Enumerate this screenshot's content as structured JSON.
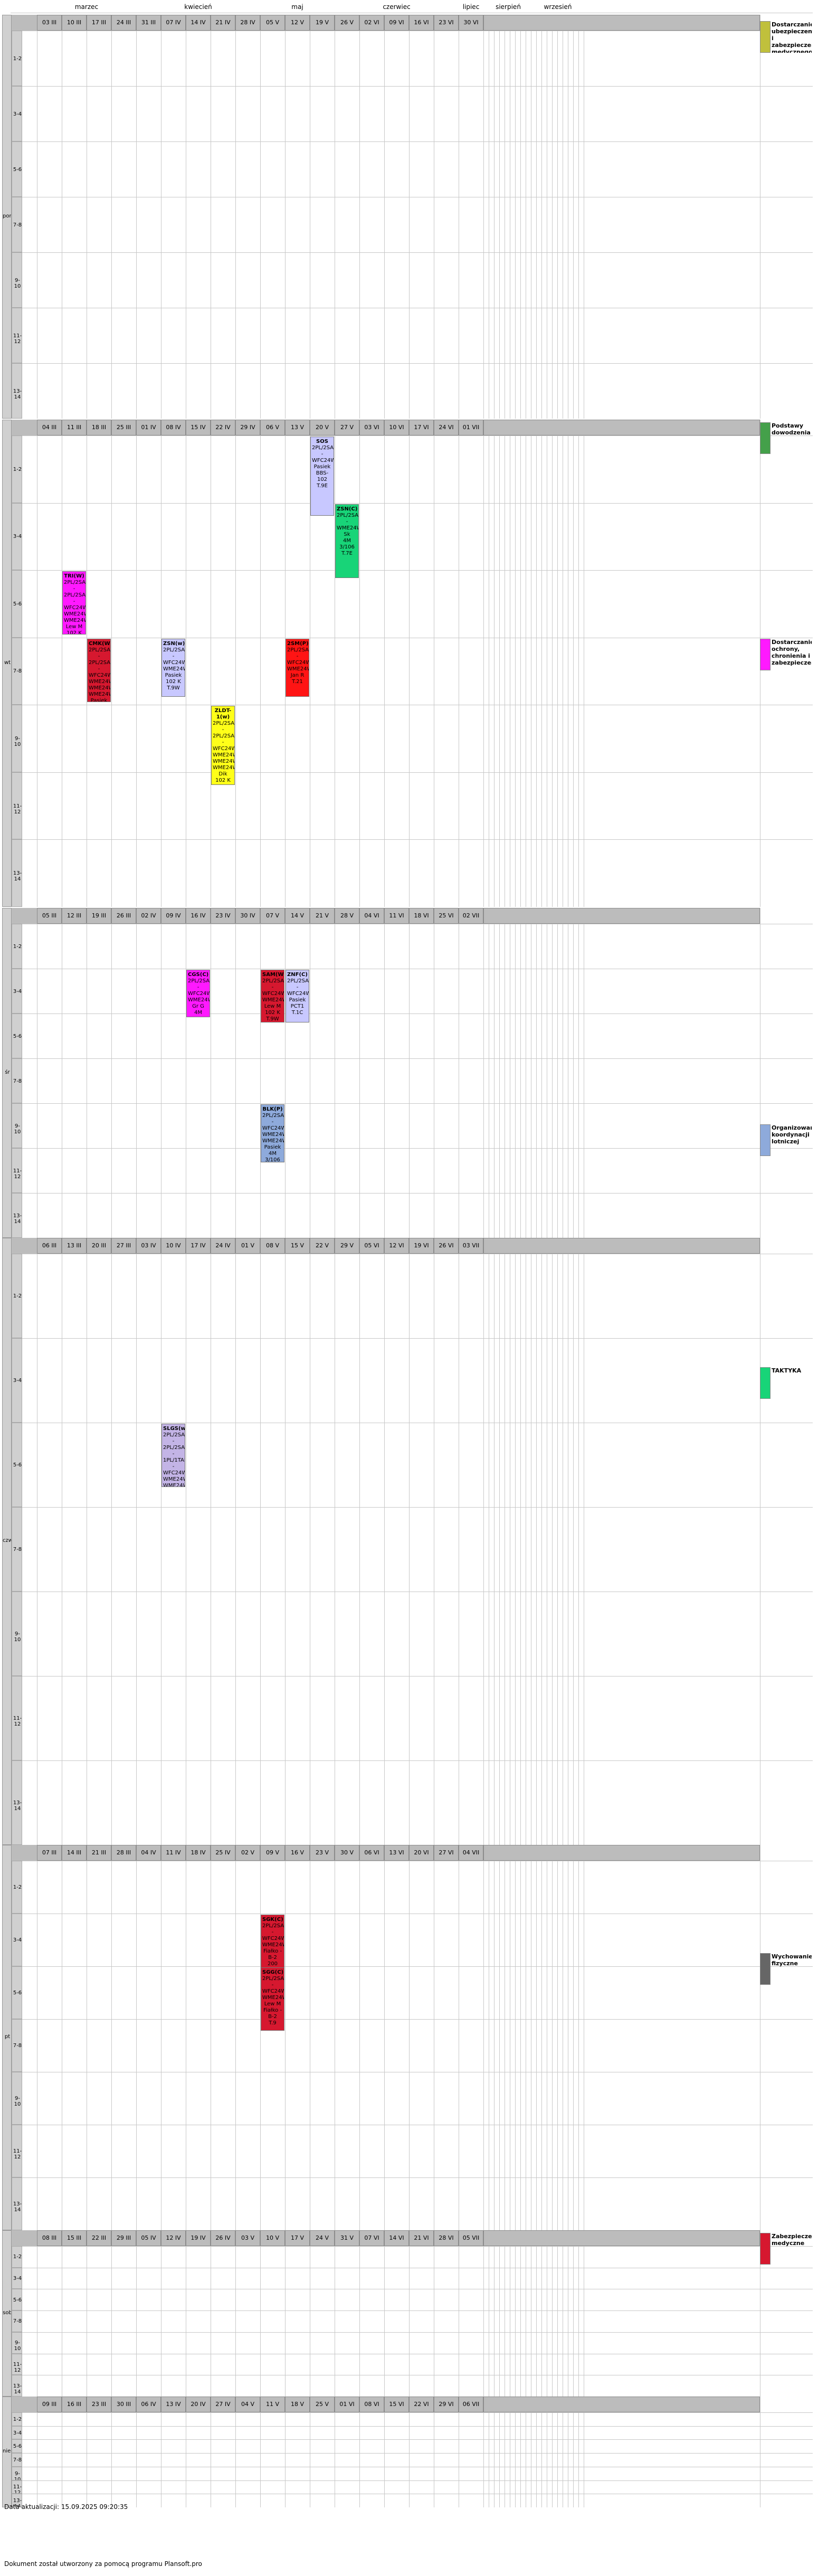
{
  "months": [
    "marzec",
    "kwiecień",
    "maj",
    "czerwiec",
    "lipiec",
    "sierpień",
    "wrzesień"
  ],
  "week_dates": {
    "pon": [
      "03 III",
      "10 III",
      "17 III",
      "24 III",
      "31 III",
      "07 IV",
      "14 IV",
      "21 IV",
      "28 IV",
      "05 V",
      "12 V",
      "19 V",
      "26 V",
      "02 VI",
      "09 VI",
      "16 VI",
      "23 VI",
      "30 VI"
    ],
    "wt": [
      "04 III",
      "11 III",
      "18 III",
      "25 III",
      "01 IV",
      "08 IV",
      "15 IV",
      "22 IV",
      "29 IV",
      "06 V",
      "13 V",
      "20 V",
      "27 V",
      "03 VI",
      "10 VI",
      "17 VI",
      "24 VI",
      "01 VII"
    ],
    "sr": [
      "05 III",
      "12 III",
      "19 III",
      "26 III",
      "02 IV",
      "09 IV",
      "16 IV",
      "23 IV",
      "30 IV",
      "07 V",
      "14 V",
      "21 V",
      "28 V",
      "04 VI",
      "11 VI",
      "18 VI",
      "25 VI",
      "02 VII"
    ],
    "czw": [
      "06 III",
      "13 III",
      "20 III",
      "27 III",
      "03 IV",
      "10 IV",
      "17 IV",
      "24 IV",
      "01 V",
      "08 V",
      "15 V",
      "22 V",
      "29 V",
      "05 VI",
      "12 VI",
      "19 VI",
      "26 VI",
      "03 VII"
    ],
    "pt": [
      "07 III",
      "14 III",
      "21 III",
      "28 III",
      "04 IV",
      "11 IV",
      "18 IV",
      "25 IV",
      "02 V",
      "09 V",
      "16 V",
      "23 V",
      "30 V",
      "06 VI",
      "13 VI",
      "20 VI",
      "27 VI",
      "04 VII"
    ],
    "sob": [
      "08 III",
      "15 III",
      "22 III",
      "29 III",
      "05 IV",
      "12 IV",
      "19 IV",
      "26 IV",
      "03 V",
      "10 V",
      "17 V",
      "24 V",
      "31 V",
      "07 VI",
      "14 VI",
      "21 VI",
      "28 VI",
      "05 VII"
    ],
    "niedz": [
      "09 III",
      "16 III",
      "23 III",
      "30 III",
      "06 IV",
      "13 IV",
      "20 IV",
      "27 IV",
      "04 V",
      "11 V",
      "18 V",
      "25 V",
      "01 VI",
      "08 VI",
      "15 VI",
      "22 VI",
      "29 VI",
      "06 VII"
    ]
  },
  "days": [
    {
      "name": "pon",
      "slots": [
        "1-2",
        "3-4",
        "5-6",
        "7-8",
        "9-10",
        "11-12",
        "13-14"
      ]
    },
    {
      "name": "wt",
      "slots": [
        "1-2",
        "3-4",
        "5-6",
        "7-8",
        "9-10",
        "11-12",
        "13-14"
      ]
    },
    {
      "name": "śr",
      "slots": [
        "1-2",
        "3-4",
        "5-6",
        "7-8",
        "9-10",
        "11-12",
        "13-14"
      ]
    },
    {
      "name": "czw",
      "slots": [
        "1-2",
        "3-4",
        "5-6",
        "7-8",
        "9-10",
        "11-12",
        "13-14"
      ]
    },
    {
      "name": "pt",
      "slots": [
        "1-2",
        "3-4",
        "5-6",
        "7-8",
        "9-10",
        "11-12",
        "13-14"
      ]
    },
    {
      "name": "sob",
      "slots": [
        "1-2",
        "3-4",
        "5-6",
        "7-8",
        "9-10",
        "11-12",
        "13-14"
      ]
    },
    {
      "name": "niedz",
      "slots": [
        "1-2",
        "3-4",
        "5-6",
        "7-8",
        "9-10",
        "11-12",
        "13-14"
      ]
    }
  ],
  "events": [
    {
      "title": "TUM(C)",
      "lines": [
        "2PL/2SAP -",
        "WFC24WC0",
        "WME24WC0",
        "Fiałko - B-2",
        "Fiałko - B-2",
        "208",
        "T.9"
      ],
      "color": "#d6182f"
    },
    {
      "title": "SGK(C)",
      "lines": [
        "2PL/2SAP -",
        "WFC24WC0",
        "WME24WC0",
        "Fiałko - B-2",
        "200",
        "T.9"
      ],
      "color": "#d6182f"
    },
    {
      "title": "SGG(C)",
      "lines": [
        "2PL/2SAP -",
        "WFC24WC0",
        "WME24WC0",
        "Lew M",
        "Fiałko - B-2",
        "T.9"
      ],
      "color": "#d6182f"
    },
    {
      "title": "SLGS(w)",
      "lines": [
        "2PL/2SAP -",
        "2PL/2SAP -",
        "1PL/1TAP -",
        "WFC24WC0",
        "WME24WC0",
        "WME24WC0",
        "WME24WC0",
        "WBI24WC0",
        "Krik",
        "016 S",
        "T.9W"
      ],
      "color": "#c3b4e6"
    },
    {
      "title": "2SM(P)",
      "lines": [
        "2PL/2SAP -",
        "WFC24WC0",
        "WME24WC0",
        "Jan R",
        "T.21"
      ],
      "color": "#ff1414"
    },
    {
      "title": "SOS",
      "lines": [
        "2PL/2SAP -",
        "WFC24WC0",
        "Pasiek",
        "BBS-102",
        "T.9E"
      ],
      "color": "#c8c8ff"
    },
    {
      "title": "ZSN(C)",
      "lines": [
        "2PL/2SAP -",
        "WME24WC0",
        "Sk",
        "4M 3/106",
        "T.7E"
      ],
      "color": "#18d478"
    },
    {
      "title": "TRI(W)",
      "lines": [
        "2PL/2SAP -",
        "2PL/2SAP -",
        "WFC24WC0",
        "WME24WC0",
        "WME24WC0",
        "Lew M",
        "102 K",
        "T.9W"
      ],
      "color": "#ff19ff"
    },
    {
      "title": "CMK(W)",
      "lines": [
        "2PL/2SAP -",
        "2PL/2SAP -",
        "WFC24WC0",
        "WME24WC0",
        "WME24WC0",
        "WME24WC0",
        "Pasiek",
        "102 K",
        "T.9W"
      ],
      "color": "#d6182f"
    },
    {
      "title": "ZSN(w)",
      "lines": [
        "2PL/2SAP -",
        "WFC24WC0",
        "WME24WC0",
        "Pasiek",
        "102 K",
        "T.9W"
      ],
      "color": "#c8c8ff"
    },
    {
      "title": "ZLDT-1(w)",
      "lines": [
        "2PL/2SAP -",
        "2PL/2SAP -",
        "WFC24WC0",
        "WME24WC0",
        "WME24WC0",
        "WME24WC0",
        "Dik",
        "102 K",
        "T.9W"
      ],
      "color": "#ffff19"
    },
    {
      "title": "CGS(C)",
      "lines": [
        "2PL/2SAP -",
        "WFC24WC0",
        "WME24WC0",
        "Gr G",
        "4M 3/106",
        "T.7E"
      ],
      "color": "#ff19ff"
    },
    {
      "title": "SAM(W)",
      "lines": [
        "2PL/2SAP -",
        "WFC24WC0",
        "WME24WC0",
        "Lew M",
        "102 K",
        "T.9W"
      ],
      "color": "#d6182f"
    },
    {
      "title": "ZNF(C)",
      "lines": [
        "2PL/2SAP -",
        "WFC24WC0",
        "Pasiek",
        "PCT1",
        "T.1C"
      ],
      "color": "#c8c8ff"
    },
    {
      "title": "BLK(P)",
      "lines": [
        "2PL/2SAP -",
        "WFC24WC0",
        "WME24WC0",
        "WME24WC0",
        "Pasiek",
        "4M 3/106",
        "T.1W"
      ],
      "color": "#8eaadb"
    }
  ],
  "legend": [
    {
      "label": "Dostarczanie ubezpieczenia i zabezpieczenia medycznego",
      "color": "#c0c03c"
    },
    {
      "label": "Podstawy dowodzenia",
      "color": "#44a04a"
    },
    {
      "label": "Dostarczanie ochrony, chronienia i zabezpieczenia",
      "color": "#ff19ff"
    },
    {
      "label": "Organizowanie koordynacji lotniczej",
      "color": "#8eaadb"
    },
    {
      "label": "TAKTYKA",
      "color": "#18d478"
    },
    {
      "label": "Wychowanie fizyczne",
      "color": "#666666"
    },
    {
      "label": "Zabezpieczenie medyczne",
      "color": "#d6182f"
    }
  ],
  "footer": {
    "updated": "Data aktualizacji: 15.09.2025 09:20:35",
    "generated": "Dokument został utworzony za pomocą programu Plansoft.pro"
  }
}
